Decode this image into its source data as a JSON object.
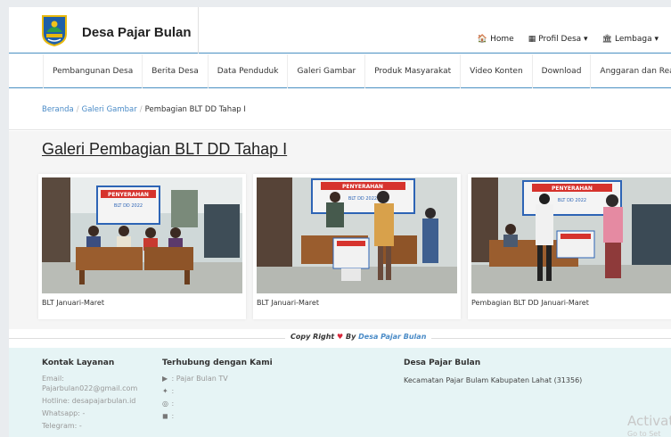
{
  "brand": {
    "name": "Desa Pajar Bulan"
  },
  "topnav": [
    {
      "icon": "home-icon",
      "glyph": "🏠",
      "label": "Home"
    },
    {
      "icon": "grid-icon",
      "glyph": "▦",
      "label": "Profil Desa ▾"
    },
    {
      "icon": "institution-icon",
      "glyph": "🏛",
      "label": "Lembaga ▾"
    }
  ],
  "menu": [
    "Pembangunan Desa",
    "Berita Desa",
    "Data Penduduk",
    "Galeri Gambar",
    "Produk Masyarakat",
    "Video Konten",
    "Download",
    "Anggaran dan Realisasi"
  ],
  "breadcrumb": {
    "home": "Beranda",
    "gallery": "Galeri Gambar",
    "current": "Pembagian BLT DD Tahap I"
  },
  "page_title": "Galeri Pembagian BLT DD Tahap I",
  "gallery": [
    {
      "caption": "BLT Januari-Maret",
      "banner": "PENYERAHAN",
      "sub": "BLT DD 2022"
    },
    {
      "caption": "BLT Januari-Maret",
      "banner": "PENYERAHAN",
      "sub": "BLT DD 2022"
    },
    {
      "caption": "Pembagian BLT DD Januari-Maret",
      "banner": "PENYERAHAN",
      "sub": "BLT DD 2022"
    }
  ],
  "copyright": {
    "prefix": "Copy Right",
    "by": "By",
    "link": "Desa Pajar Bulan"
  },
  "footer": {
    "kontak": {
      "title": "Kontak Layanan",
      "email_label": "Email:",
      "email": "Pajarbulan022@gmail.com",
      "hotline": "Hotline: desapajarbulan.id",
      "whatsapp": "Whatsapp: -",
      "telegram": "Telegram: -"
    },
    "social": {
      "title": "Terhubung dengan Kami",
      "youtube": ": Pajar Bulan TV",
      "twitter": ":",
      "instagram": ":",
      "facebook": ":"
    },
    "desa": {
      "title": "Desa Pajar Bulan",
      "address": "Kecamatan Pajar Bulam Kabupaten Lahat (31356)"
    }
  },
  "watermark": {
    "title": "Activat",
    "sub": "Go to Set"
  },
  "colors": {
    "accent": "#4a8bc7",
    "footer_bg": "#e6f4f5",
    "heart": "#d9263a"
  }
}
